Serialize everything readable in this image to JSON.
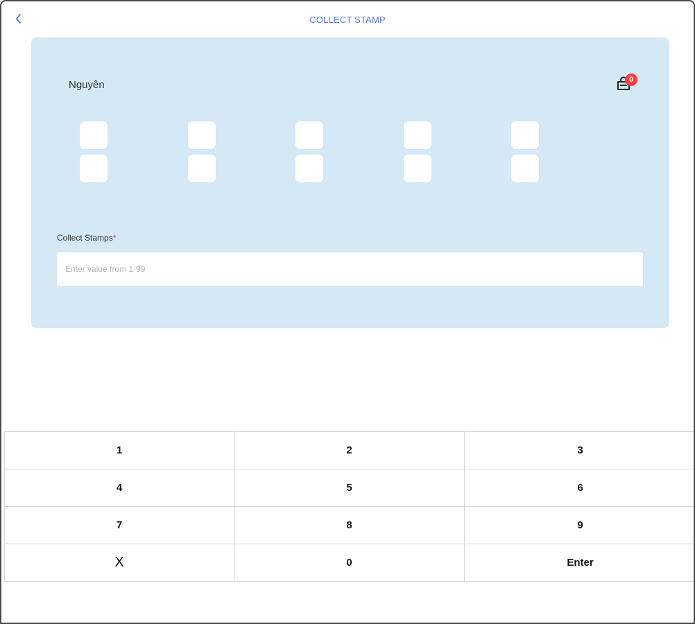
{
  "header": {
    "title": "COLLECT STAMP",
    "back_icon": "chevron-left-icon"
  },
  "colors": {
    "accent": "#5b7be0",
    "card_bg": "#d4e8f5",
    "badge": "#ff3b3b"
  },
  "card": {
    "customer_name": "Nguyên",
    "bag_icon": "shopping-bag-icon",
    "badge_count": "0",
    "stamp_slots": 10,
    "collect_label": "Collect Stamps",
    "required_marker": "*",
    "input_value": "",
    "input_placeholder": "Enter value from 1-99"
  },
  "keypad": {
    "keys": [
      "1",
      "2",
      "3",
      "4",
      "5",
      "6",
      "7",
      "8",
      "9",
      "X",
      "0",
      "Enter"
    ]
  }
}
